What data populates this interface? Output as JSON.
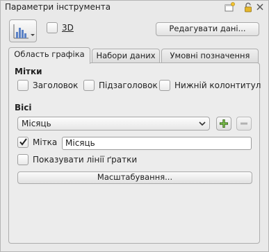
{
  "window": {
    "title": "Параметри інструмента"
  },
  "toolbar": {
    "chart_type_icon": "bar-chart-icon",
    "checkbox_3d_label": "3D",
    "edit_data_button": "Редагувати дані..."
  },
  "tabs": [
    {
      "label": "Область графіка",
      "active": true
    },
    {
      "label": "Набори даних",
      "active": false
    },
    {
      "label": "Умовні позначення",
      "active": false
    }
  ],
  "labels_section": {
    "heading": "Мітки",
    "title_checkbox": "Заголовок",
    "subtitle_checkbox": "Підзаголовок",
    "footer_checkbox": "Нижній колонтитул"
  },
  "axes_section": {
    "heading": "Вісі",
    "axis_select_value": "Місяць",
    "label_checkbox": "Мітка",
    "label_checked": true,
    "label_input_value": "Місяць",
    "gridlines_checkbox": "Показувати лінії ґратки",
    "scaling_button": "Масштабування..."
  },
  "colors": {
    "background": "#e9e9e9",
    "border": "#adadad"
  }
}
